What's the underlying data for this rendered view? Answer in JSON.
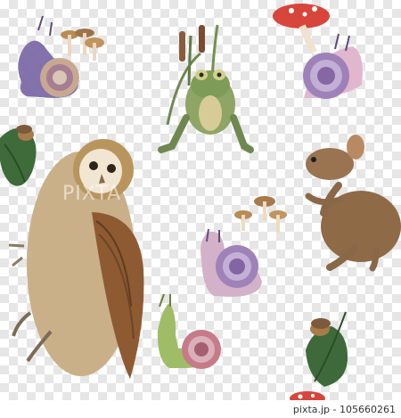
{
  "image": {
    "credit": "pixta.jp - 105660261",
    "watermark": "PIXTA"
  },
  "colors": {
    "owl_body": "#c9b089",
    "owl_wing": "#8d5a32",
    "frog": "#7f9b58",
    "mouse": "#8f6a47",
    "snail_shell": "#a07cb8",
    "mushroom": "#b07a4a",
    "amanita_cap": "#d8453a",
    "oak_leaf": "#3f6a3a",
    "acorn": "#a77b4a"
  },
  "icons": [
    "owl-illustration",
    "frog-illustration",
    "mouse-illustration",
    "snail-illustration",
    "mushroom-illustration",
    "oak-leaf-illustration",
    "acorn-illustration"
  ]
}
